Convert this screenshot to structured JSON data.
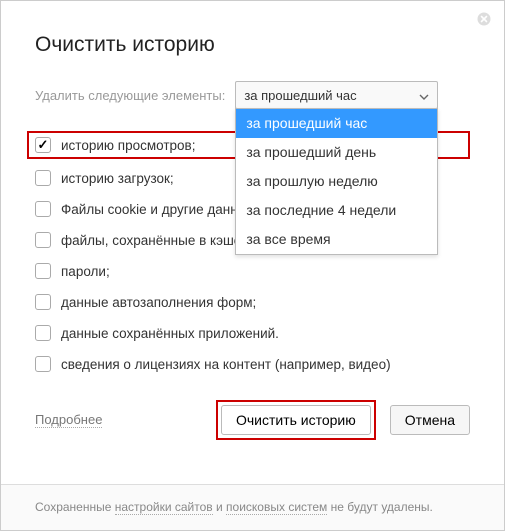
{
  "title": "Очистить историю",
  "select_label": "Удалить следующие элементы:",
  "select_value": "за прошедший час",
  "dropdown": {
    "items": [
      {
        "label": "за прошедший час",
        "selected": true
      },
      {
        "label": "за прошедший день",
        "selected": false
      },
      {
        "label": "за прошлую неделю",
        "selected": false
      },
      {
        "label": "за последние 4 недели",
        "selected": false
      },
      {
        "label": "за все время",
        "selected": false
      }
    ]
  },
  "checks": [
    {
      "label": "историю просмотров;",
      "checked": true,
      "highlighted": true
    },
    {
      "label": "историю загрузок;",
      "checked": false,
      "highlighted": false
    },
    {
      "label": "Файлы cookie и другие данные сайтов и модулей",
      "checked": false,
      "highlighted": false
    },
    {
      "label": "файлы, сохранённые в кэше;",
      "checked": false,
      "highlighted": false
    },
    {
      "label": "пароли;",
      "checked": false,
      "highlighted": false
    },
    {
      "label": "данные автозаполнения форм;",
      "checked": false,
      "highlighted": false
    },
    {
      "label": "данные сохранённых приложений.",
      "checked": false,
      "highlighted": false
    },
    {
      "label": "сведения о лицензиях на контент (например, видео)",
      "checked": false,
      "highlighted": false
    }
  ],
  "more_link": "Подробнее",
  "btn_clear": "Очистить историю",
  "btn_cancel": "Отмена",
  "footer": {
    "t1": "Сохраненные ",
    "l1": "настройки сайтов",
    "t2": " и ",
    "l2": "поисковых систем",
    "t3": " не будут удалены."
  }
}
